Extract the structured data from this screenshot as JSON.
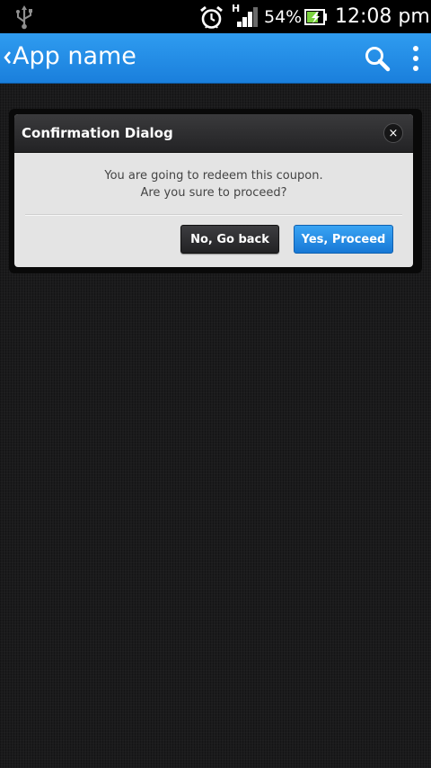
{
  "status_bar": {
    "network_type": "H",
    "battery_percent": "54%",
    "time": "12:08 pm",
    "icons": [
      "usb-icon",
      "alarm-icon",
      "signal-icon",
      "battery-icon"
    ]
  },
  "action_bar": {
    "title": "App name",
    "icons": [
      "up-caret-icon",
      "search-icon",
      "overflow-menu-icon"
    ],
    "color": "#1f86e2"
  },
  "dialog": {
    "title": "Confirmation Dialog",
    "close_symbol": "×",
    "message_line1": "You are going to redeem this coupon.",
    "message_line2": "Are you sure to proceed?",
    "cancel_label": "No, Go back",
    "confirm_label": "Yes, Proceed"
  }
}
